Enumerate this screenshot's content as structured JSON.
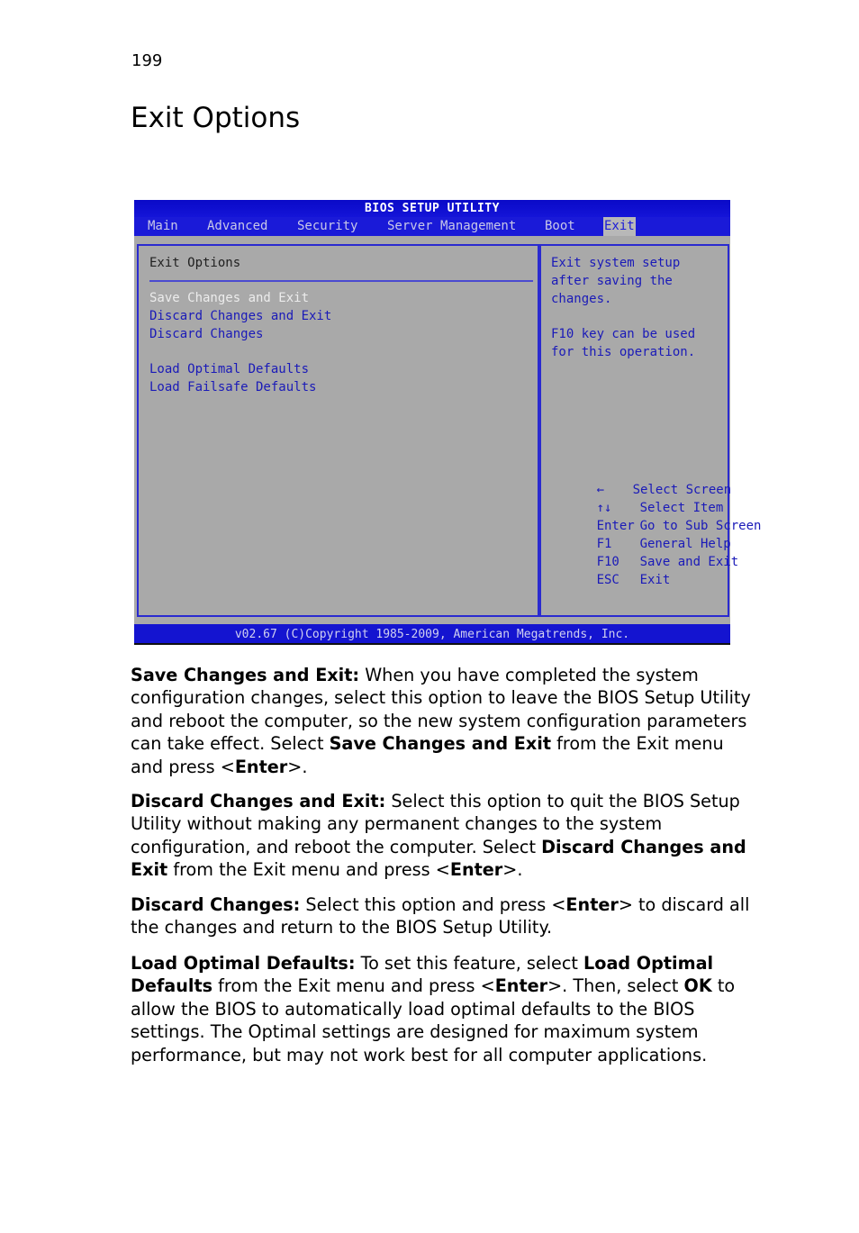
{
  "page_number": "199",
  "title": "Exit Options",
  "bios": {
    "title": "BIOS SETUP UTILITY",
    "tabs": [
      {
        "label": "Main",
        "active": false
      },
      {
        "label": "Advanced",
        "active": false
      },
      {
        "label": "Security",
        "active": false
      },
      {
        "label": "Server Management",
        "active": false
      },
      {
        "label": "Boot",
        "active": false
      },
      {
        "label": "Exit",
        "active": true
      }
    ],
    "panel_heading": "Exit Options",
    "options": [
      {
        "label": "Save Changes and Exit",
        "selected": true
      },
      {
        "label": "Discard Changes and Exit",
        "selected": false
      },
      {
        "label": "Discard Changes",
        "selected": false
      },
      {
        "label": "Load Optimal Defaults",
        "selected": false
      },
      {
        "label": "Load Failsafe Defaults",
        "selected": false
      }
    ],
    "help_lines": [
      "Exit system setup",
      "after saving the",
      "changes.",
      "F10 key can be used",
      "for this operation."
    ],
    "keys": [
      {
        "key": "←",
        "icon": "left-arrow-icon",
        "action": "Select Screen"
      },
      {
        "key": "↑↓",
        "icon": "up-down-arrows-icon",
        "action": "Select Item"
      },
      {
        "key": "Enter",
        "action": "Go to Sub Screen"
      },
      {
        "key": "F1",
        "action": "General Help"
      },
      {
        "key": "F10",
        "action": "Save and Exit"
      },
      {
        "key": "ESC",
        "action": "Exit"
      }
    ],
    "footer": "v02.67 (C)Copyright 1985-2009, American Megatrends, Inc.",
    "colors": {
      "title_bar": "#0a0ac8",
      "menu_bar": "#1a1ad8",
      "panel": "#a9a9a9",
      "option_text": "#1a1ab8",
      "selected_text": "#ececec"
    }
  },
  "paragraphs": [
    {
      "term": "Save Changes and Exit:",
      "parts": [
        {
          "t": " When you have completed the system configuration changes, select this option to leave the BIOS Setup Utility and reboot the computer, so the new system configuration parameters can take effect. Select ",
          "b": false
        },
        {
          "t": "Save Changes and Exit",
          "b": true
        },
        {
          "t": " from the Exit menu and press <",
          "b": false
        },
        {
          "t": "Enter",
          "b": true
        },
        {
          "t": ">.",
          "b": false
        }
      ]
    },
    {
      "term": "Discard Changes and Exit:",
      "parts": [
        {
          "t": " Select this option to quit the BIOS Setup Utility without making any permanent changes to the system configuration, and reboot the computer. Select ",
          "b": false
        },
        {
          "t": "Discard Changes and Exit",
          "b": true
        },
        {
          "t": " from the Exit menu and press <",
          "b": false
        },
        {
          "t": "Enter",
          "b": true
        },
        {
          "t": ">.",
          "b": false
        }
      ]
    },
    {
      "term": "Discard Changes:",
      "parts": [
        {
          "t": " Select this option and press <",
          "b": false
        },
        {
          "t": "Enter",
          "b": true
        },
        {
          "t": "> to discard all the changes and return to the BIOS Setup Utility.",
          "b": false
        }
      ]
    },
    {
      "term": "Load Optimal Defaults:",
      "parts": [
        {
          "t": " To set this feature, select ",
          "b": false
        },
        {
          "t": "Load Optimal Defaults",
          "b": true
        },
        {
          "t": " from the Exit menu and press <",
          "b": false
        },
        {
          "t": "Enter",
          "b": true
        },
        {
          "t": ">. Then, select ",
          "b": false
        },
        {
          "t": "OK",
          "b": true
        },
        {
          "t": " to allow the BIOS to automatically load optimal defaults to the BIOS settings. The Optimal settings are designed for maximum system performance, but may not work best for all computer applications.",
          "b": false
        }
      ]
    }
  ]
}
